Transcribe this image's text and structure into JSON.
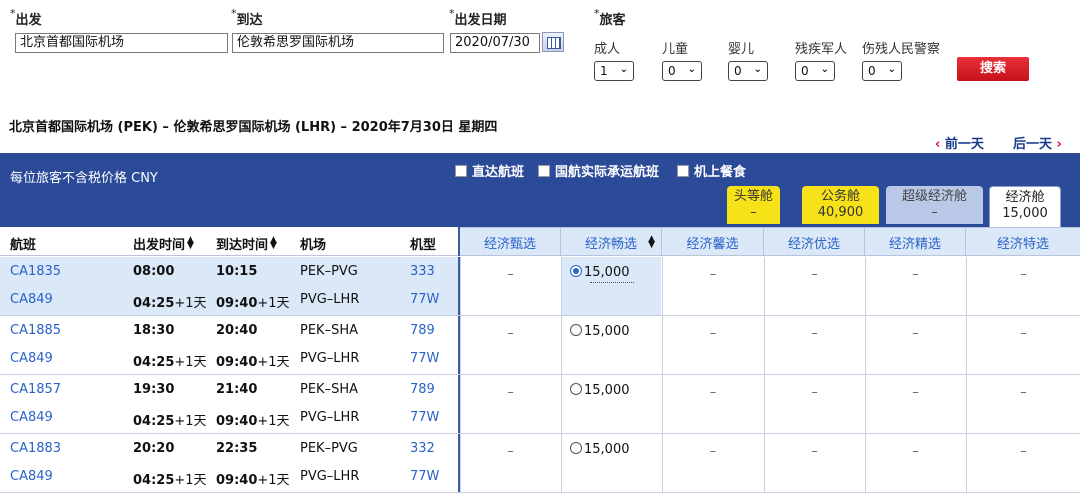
{
  "form": {
    "depart_label": "出发",
    "arrive_label": "到达",
    "date_label": "出发日期",
    "pax_label": "旅客",
    "depart_value": "北京首都国际机场",
    "arrive_value": "伦敦希思罗国际机场",
    "date_value": "2020/07/30",
    "required_mark": "*",
    "passengers": [
      {
        "label": "成人",
        "value": "1"
      },
      {
        "label": "儿童",
        "value": "0"
      },
      {
        "label": "婴儿",
        "value": "0"
      },
      {
        "label": "残疾军人",
        "value": "0"
      },
      {
        "label": "伤残人民警察",
        "value": "0"
      }
    ],
    "search_label": "搜索"
  },
  "route": "北京首都国际机场 (PEK) – 伦敦希思罗国际机场 (LHR) – 2020年7月30日 星期四",
  "nav": {
    "prev": "前一天",
    "next": "后一天",
    "prev_arrow": "‹",
    "next_arrow": "›"
  },
  "bar": {
    "price_note": "每位旅客不含税价格 CNY",
    "filters": [
      "直达航班",
      "国航实际承运航班",
      "机上餐食"
    ]
  },
  "cabins": [
    {
      "name": "头等舱",
      "price": "–"
    },
    {
      "name": "公务舱",
      "price": "40,900"
    },
    {
      "name": "超级经济舱",
      "price": "–"
    },
    {
      "name": "经济舱",
      "price": "15,000"
    }
  ],
  "columns": {
    "flight": "航班",
    "dep_time": "出发时间",
    "arr_time": "到达时间",
    "airport": "机场",
    "aircraft": "机型",
    "fares": [
      "经济甄选",
      "经济畅选",
      "经济馨选",
      "经济优选",
      "经济精选",
      "经济特选"
    ]
  },
  "rows": [
    {
      "selected": true,
      "legs": [
        {
          "flight": "CA1835",
          "dep": "08:00",
          "dep_plus": "",
          "arr": "10:15",
          "arr_plus": "",
          "airport": "PEK–PVG",
          "aircraft": "333"
        },
        {
          "flight": "CA849",
          "dep": "04:25",
          "dep_plus": "+1天",
          "arr": "09:40",
          "arr_plus": "+1天",
          "airport": "PVG–LHR",
          "aircraft": "77W"
        }
      ],
      "fares": [
        "–",
        "15,000",
        "–",
        "–",
        "–",
        "–"
      ]
    },
    {
      "selected": false,
      "legs": [
        {
          "flight": "CA1885",
          "dep": "18:30",
          "dep_plus": "",
          "arr": "20:40",
          "arr_plus": "",
          "airport": "PEK–SHA",
          "aircraft": "789"
        },
        {
          "flight": "CA849",
          "dep": "04:25",
          "dep_plus": "+1天",
          "arr": "09:40",
          "arr_plus": "+1天",
          "airport": "PVG–LHR",
          "aircraft": "77W"
        }
      ],
      "fares": [
        "–",
        "15,000",
        "–",
        "–",
        "–",
        "–"
      ]
    },
    {
      "selected": false,
      "legs": [
        {
          "flight": "CA1857",
          "dep": "19:30",
          "dep_plus": "",
          "arr": "21:40",
          "arr_plus": "",
          "airport": "PEK–SHA",
          "aircraft": "789"
        },
        {
          "flight": "CA849",
          "dep": "04:25",
          "dep_plus": "+1天",
          "arr": "09:40",
          "arr_plus": "+1天",
          "airport": "PVG–LHR",
          "aircraft": "77W"
        }
      ],
      "fares": [
        "–",
        "15,000",
        "–",
        "–",
        "–",
        "–"
      ]
    },
    {
      "selected": false,
      "legs": [
        {
          "flight": "CA1883",
          "dep": "20:20",
          "dep_plus": "",
          "arr": "22:35",
          "arr_plus": "",
          "airport": "PEK–PVG",
          "aircraft": "332"
        },
        {
          "flight": "CA849",
          "dep": "04:25",
          "dep_plus": "+1天",
          "arr": "09:40",
          "arr_plus": "+1天",
          "airport": "PVG–LHR",
          "aircraft": "77W"
        }
      ],
      "fares": [
        "–",
        "15,000",
        "–",
        "–",
        "–",
        "–"
      ]
    }
  ],
  "colors": {
    "bar": "#2b4a98",
    "accent_red": "#d4101a",
    "link_blue": "#2a62c8",
    "first_tab": "#f7e21a",
    "business_tab": "#f7e21a",
    "premium_tab": "#b9c8e6",
    "economy_tab": "#ffffff",
    "selected_row": "#dbe8f8"
  }
}
